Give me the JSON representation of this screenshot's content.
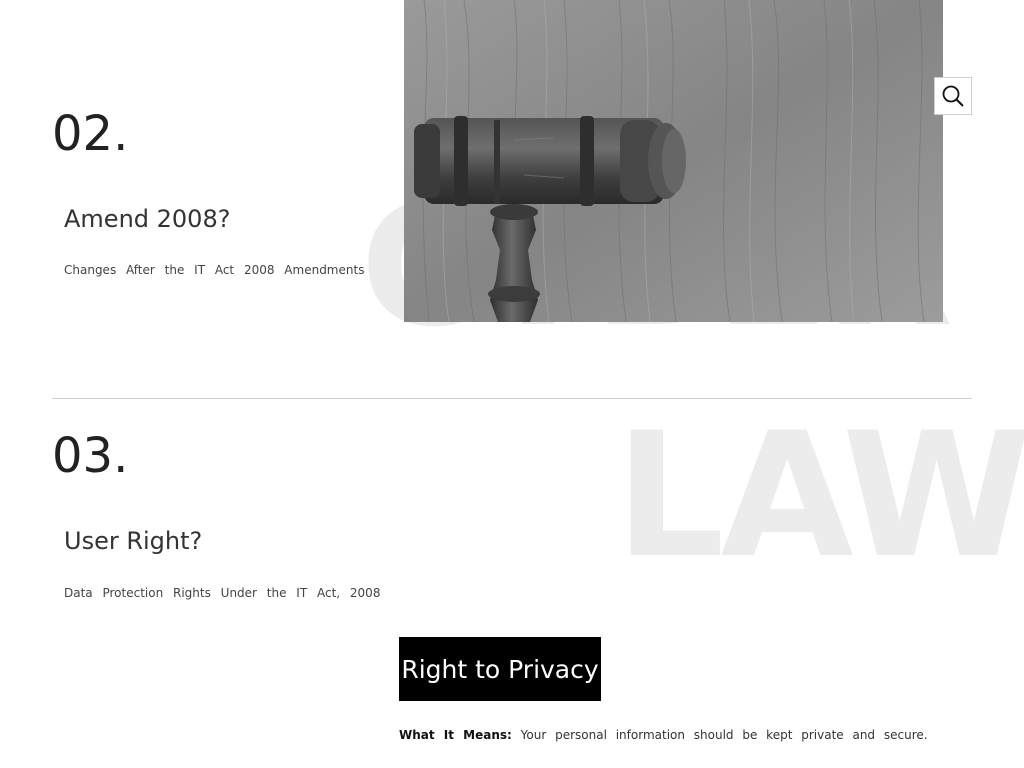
{
  "section_02": {
    "number": "02.",
    "title": "Amend 2008?",
    "subtitle": "Changes After the IT Act 2008 Amendments",
    "watermark": "CYBER"
  },
  "section_03": {
    "number": "03.",
    "title": "User Right?",
    "subtitle": "Data Protection Rights Under the IT Act, 2008",
    "watermark": "LAW"
  },
  "search": {
    "icon": "search-icon"
  },
  "hero": {
    "image": "gavel-on-wood"
  },
  "privacy": {
    "button_label": "Right to Privacy",
    "what_label": "What It Means:",
    "what_text": " Your personal information should be kept private and secure."
  }
}
